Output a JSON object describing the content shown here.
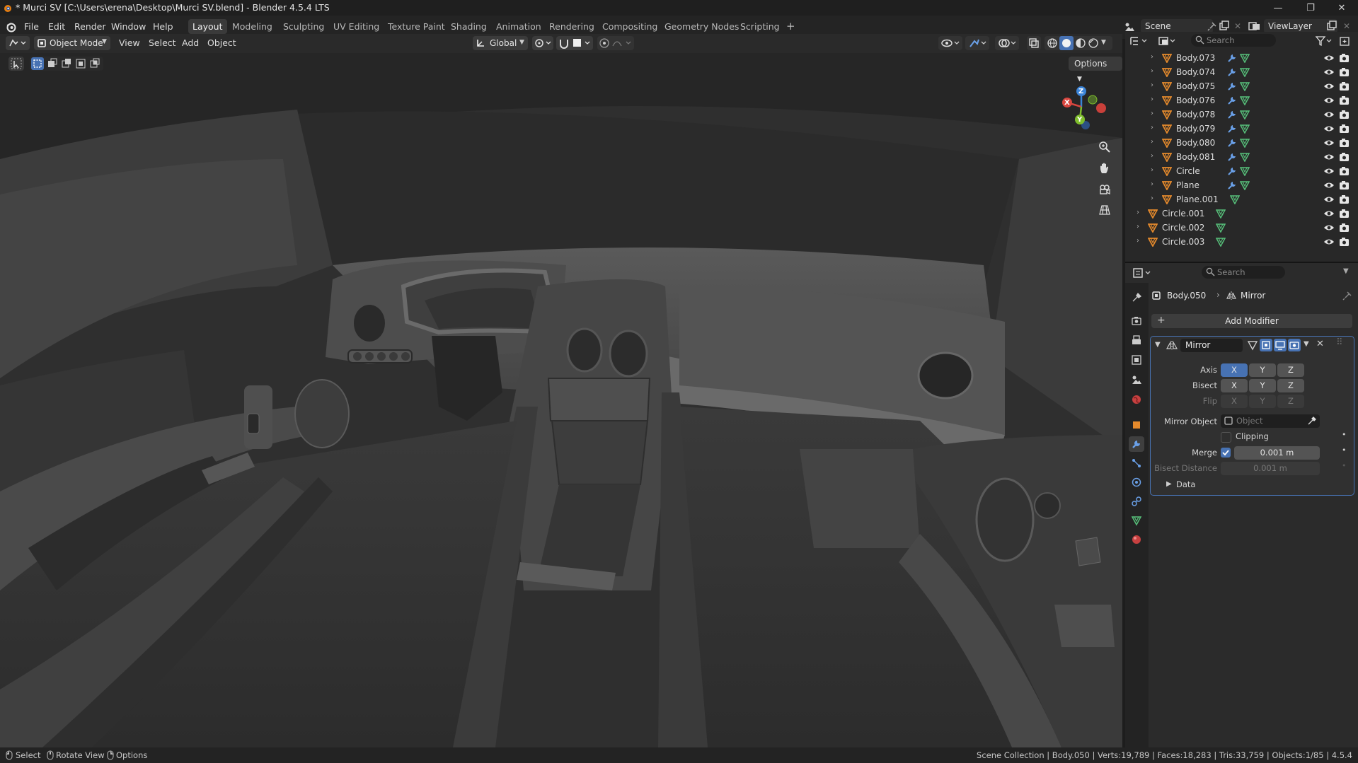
{
  "window": {
    "title": "* Murci SV [C:\\Users\\erena\\Desktop\\Murci SV.blend] - Blender 4.5.4 LTS",
    "minimize_glyph": "—",
    "maximize_glyph": "❐",
    "close_glyph": "✕"
  },
  "menu": {
    "items": [
      "File",
      "Edit",
      "Render",
      "Window",
      "Help"
    ]
  },
  "workspaces": [
    "Layout",
    "Modeling",
    "Sculpting",
    "UV Editing",
    "Texture Paint",
    "Shading",
    "Animation",
    "Rendering",
    "Compositing",
    "Geometry Nodes",
    "Scripting"
  ],
  "workspace_add": "+",
  "scene": {
    "label": "Scene",
    "view_layer": "ViewLayer"
  },
  "viewport_header": {
    "mode": "Object Mode",
    "menus": [
      "View",
      "Select",
      "Add",
      "Object"
    ],
    "orientation": "Global",
    "options_label": "Options"
  },
  "gizmo": {
    "x_label": "X",
    "y_label": "Y",
    "z_label": "Z"
  },
  "outliner": {
    "search_placeholder": "Search",
    "items": [
      {
        "name": "Body.073",
        "modifier": true
      },
      {
        "name": "Body.074",
        "modifier": true
      },
      {
        "name": "Body.075",
        "modifier": true
      },
      {
        "name": "Body.076",
        "modifier": true
      },
      {
        "name": "Body.078",
        "modifier": true
      },
      {
        "name": "Body.079",
        "modifier": true
      },
      {
        "name": "Body.080",
        "modifier": true
      },
      {
        "name": "Body.081",
        "modifier": true
      },
      {
        "name": "Circle",
        "modifier": true
      },
      {
        "name": "Plane",
        "modifier": true
      },
      {
        "name": "Plane.001",
        "modifier": false
      },
      {
        "name": "Circle.001",
        "modifier": false
      },
      {
        "name": "Circle.002",
        "modifier": false
      },
      {
        "name": "Circle.003",
        "modifier": false
      }
    ]
  },
  "properties": {
    "search_placeholder": "Search",
    "breadcrumb_object": "Body.050",
    "breadcrumb_modifier": "Mirror",
    "add_modifier_label": "Add Modifier",
    "modifier_name": "Mirror",
    "axis_label": "Axis",
    "bisect_label": "Bisect",
    "flip_label": "Flip",
    "axes": [
      "X",
      "Y",
      "Z"
    ],
    "axis_active": "X",
    "mirror_object_label": "Mirror Object",
    "mirror_object_placeholder": "Object",
    "clipping_label": "Clipping",
    "clipping_checked": false,
    "merge_label": "Merge",
    "merge_checked": true,
    "merge_value": "0.001 m",
    "bisect_distance_label": "Bisect Distance",
    "bisect_distance_value": "0.001 m",
    "data_label": "Data"
  },
  "statusbar": {
    "select": "Select",
    "rotate": "Rotate View",
    "options": "Options",
    "stats": "Scene Collection | Body.050 | Verts:19,789 | Faces:18,283 | Tris:33,759 | Objects:1/85 | 4.5.4"
  },
  "colors": {
    "accent": "#4772b3",
    "mesh_orange": "#e58a2c",
    "mesh_green": "#57c07a",
    "modifier_blue": "#6aa0e8",
    "gizmo_x": "#d9463f",
    "gizmo_y": "#7fbe2c",
    "gizmo_z": "#3b84d8"
  }
}
